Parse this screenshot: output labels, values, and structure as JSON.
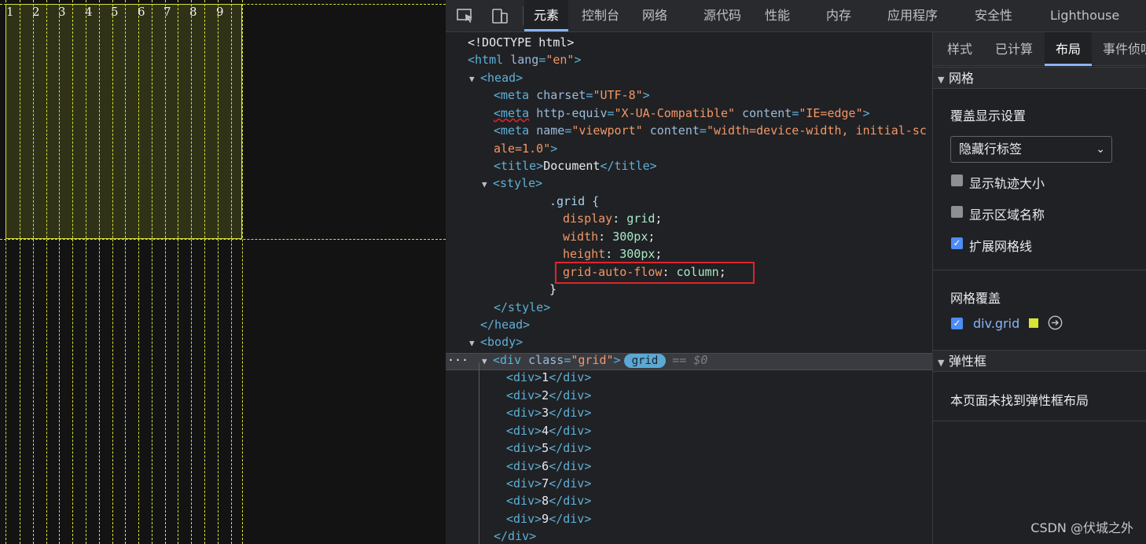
{
  "viewport": {
    "cell_numbers": [
      "1",
      "2",
      "3",
      "4",
      "5",
      "6",
      "7",
      "8",
      "9"
    ],
    "overlay_color": "#d8df3a"
  },
  "devtools": {
    "tabs": [
      "元素",
      "控制台",
      "网络",
      "源代码",
      "性能",
      "内存",
      "应用程序",
      "安全性",
      "Lighthouse"
    ],
    "active_tab": "元素",
    "icons": [
      "inspect-element-icon",
      "device-toolbar-icon"
    ]
  },
  "dom": {
    "doctype": "<!DOCTYPE html>",
    "html_open": {
      "tag": "<html",
      "attr": "lang",
      "value": "\"en\"",
      "close": ">"
    },
    "head_open": "<head>",
    "meta_charset": {
      "attr": "charset",
      "value": "\"UTF-8\""
    },
    "meta_compat": {
      "attr1": "http-equiv",
      "value1": "\"X-UA-Compatible\"",
      "attr2": "content",
      "value2": "\"IE=edge\""
    },
    "meta_viewport": {
      "attr1": "name",
      "value1": "\"viewport\"",
      "attr2": "content",
      "value2_part1": "\"width=device-width, initial-sc",
      "value2_part2": "ale=1.0\""
    },
    "title": {
      "open": "<title>",
      "text": "Document",
      "close": "</title>"
    },
    "style_open": "<style>",
    "css": {
      "selector": ".grid {",
      "rules": [
        {
          "prop": "display",
          "value": "grid"
        },
        {
          "prop": "width",
          "value": "300px"
        },
        {
          "prop": "height",
          "value": "300px"
        },
        {
          "prop": "grid-auto-flow",
          "value": "column"
        }
      ],
      "close": "}"
    },
    "style_close": "</style>",
    "head_close": "</head>",
    "body_open": "<body>",
    "div_grid": {
      "tag": "<div",
      "attr": "class",
      "value": "\"grid\"",
      "close": ">",
      "badge": "grid",
      "ref": "== $0"
    },
    "ellipsis": "···",
    "children": [
      "1",
      "2",
      "3",
      "4",
      "5",
      "6",
      "7",
      "8",
      "9"
    ],
    "div_close": "</div>"
  },
  "sidebar": {
    "tabs": [
      "样式",
      "已计算",
      "布局",
      "事件侦听"
    ],
    "active_tab": "布局",
    "grid_section": "网格",
    "overlay_settings": "覆盖显示设置",
    "select_value": "隐藏行标签",
    "checkboxes": [
      {
        "label": "显示轨迹大小",
        "checked": false
      },
      {
        "label": "显示区域名称",
        "checked": false
      },
      {
        "label": "扩展网格线",
        "checked": true
      }
    ],
    "grid_overlay_title": "网格覆盖",
    "grid_overlay_item": {
      "label": "div.grid",
      "checked": true,
      "color": "#d8e436"
    },
    "flex_section": "弹性框",
    "flex_empty": "本页面未找到弹性框布局"
  },
  "watermark": "CSDN @伏城之外"
}
